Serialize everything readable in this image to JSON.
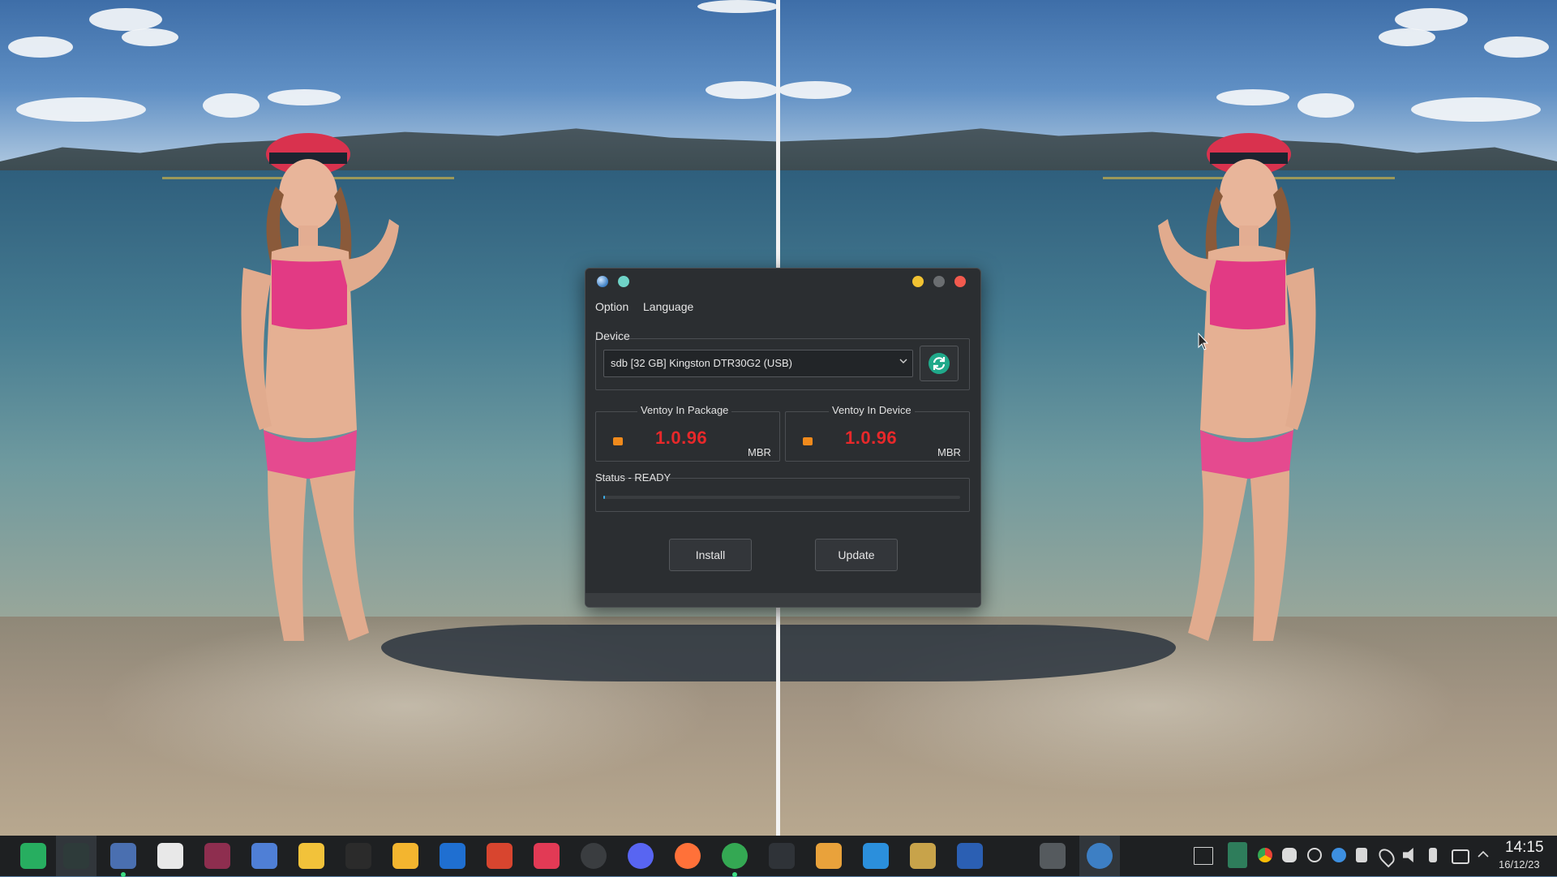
{
  "window": {
    "menu": {
      "option": "Option",
      "language": "Language"
    },
    "device": {
      "label": "Device",
      "selected": "sdb  [32 GB]  Kingston DTR30G2 (USB)"
    },
    "ventoy_in_package": {
      "label": "Ventoy In Package",
      "version": "1.0.96",
      "partition_style": "MBR"
    },
    "ventoy_in_device": {
      "label": "Ventoy In Device",
      "version": "1.0.96",
      "partition_style": "MBR"
    },
    "status": {
      "label": "Status - READY",
      "progress": 0
    },
    "buttons": {
      "install": "Install",
      "update": "Update"
    }
  },
  "colors": {
    "version_red": "#e8282a",
    "secure_boot_orange": "#f08a1c",
    "refresh_green": "#20a98a",
    "minimize": "#f1c232",
    "maximize": "#6b6e71",
    "close": "#f25a4e"
  },
  "taskbar": {
    "apps": [
      "app-launcher-icon",
      "system-monitor-icon",
      "virtualbox-icon",
      "software-store-icon",
      "media-player-icon",
      "notes-icon",
      "file-manager-icon",
      "inkscape-icon",
      "files-icon",
      "outlook-icon",
      "office-icon",
      "media-play-icon",
      "aperture-icon",
      "discord-icon",
      "firefox-icon",
      "chrome-icon",
      "terminal-icon",
      "archive-icon",
      "vscode-icon",
      "package-icon",
      "word-icon",
      "video-editor-icon",
      "ventoy-icon"
    ],
    "clock": {
      "time": "14:15",
      "date": "16/12/23"
    }
  }
}
